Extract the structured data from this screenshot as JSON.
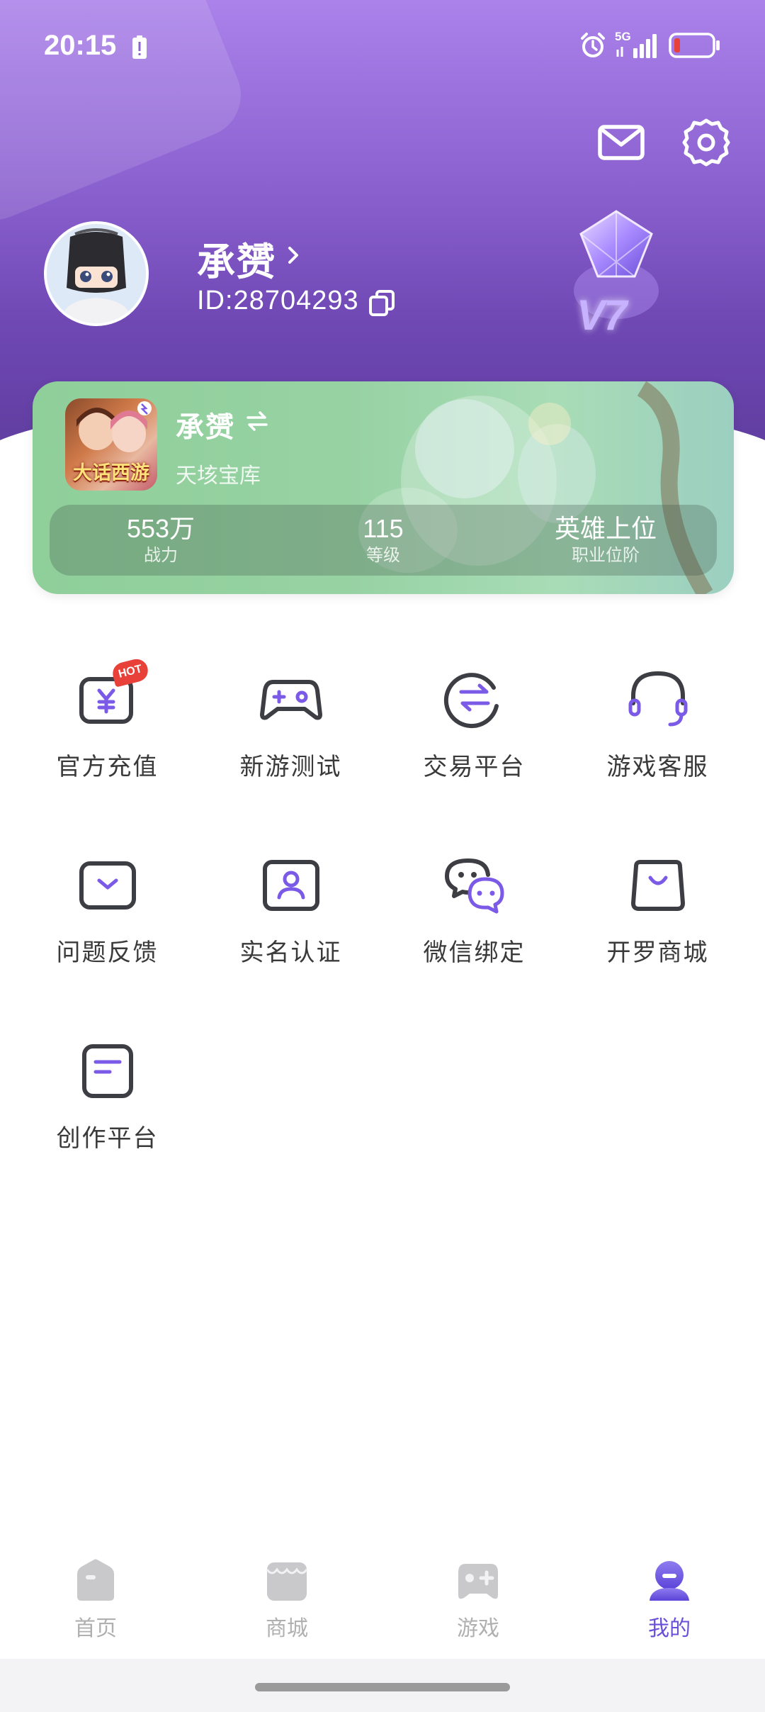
{
  "status_bar": {
    "time": "20:15",
    "network": "5G",
    "icons": [
      "battery-alert-icon",
      "alarm-icon",
      "signal-icon",
      "battery-low-icon"
    ]
  },
  "header": {
    "icons": [
      "mail-icon",
      "settings-icon"
    ]
  },
  "profile": {
    "name": "承赟",
    "id_text": "ID:28704293",
    "vip_level": "V7"
  },
  "game_card": {
    "game_logo_text": "大话西游",
    "role_name": "承赟",
    "server": "天垓宝库",
    "stats": [
      {
        "value": "553万",
        "label": "战力"
      },
      {
        "value": "115",
        "label": "等级"
      },
      {
        "value": "英雄上位",
        "label": "职业位阶"
      }
    ]
  },
  "hot_badge": "HOT",
  "menu": [
    {
      "label": "官方充值",
      "icon": "recharge-icon"
    },
    {
      "label": "新游测试",
      "icon": "gamepad-icon"
    },
    {
      "label": "交易平台",
      "icon": "trade-icon"
    },
    {
      "label": "游戏客服",
      "icon": "headset-icon"
    },
    {
      "label": "问题反馈",
      "icon": "feedback-icon"
    },
    {
      "label": "实名认证",
      "icon": "id-card-icon"
    },
    {
      "label": "微信绑定",
      "icon": "wechat-icon"
    },
    {
      "label": "开罗商城",
      "icon": "shopping-bag-icon"
    },
    {
      "label": "创作平台",
      "icon": "document-icon"
    }
  ],
  "bottom_nav": [
    {
      "label": "首页",
      "icon": "home-icon",
      "active": false
    },
    {
      "label": "商城",
      "icon": "store-icon",
      "active": false
    },
    {
      "label": "游戏",
      "icon": "game-icon",
      "active": false
    },
    {
      "label": "我的",
      "icon": "profile-icon",
      "active": true
    }
  ],
  "colors": {
    "accent": "#6a4fd8",
    "header_top": "#ab82ea",
    "header_bottom": "#5b3a99",
    "card_green": "#97d2a3",
    "icon_stroke": "#3d3d44",
    "icon_accent": "#7a5ae6"
  }
}
